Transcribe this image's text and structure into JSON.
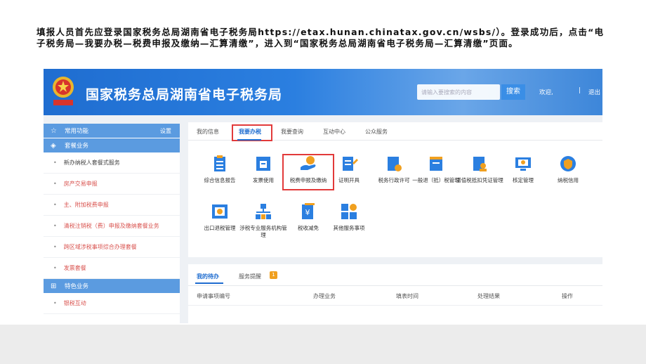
{
  "instruction": "填报人员首先应登录国家税务总局湖南省电子税务局https://etax.hunan.chinatax.gov.cn/wsbs/）。登录成功后，点击“电子税务局—我要办税—税费申报及缴纳—汇算清缴”，进入到“国家税务总局湖南省电子税务局—汇算清缴”页面。",
  "header": {
    "site_title": "国家税务总局湖南省电子税务局",
    "search_placeholder": "请输入要搜索的内容",
    "search_button": "搜索",
    "welcome": "欢迎,",
    "separator": "|",
    "logout": "退出"
  },
  "sidebar": {
    "common_label": "常用功能",
    "settings_label": "设置",
    "package_section": "套餐业务",
    "items": [
      "新办纳税人套餐式服务",
      "房产交易申报",
      "主、附加税费申报",
      "清税注销税（费）申报及缴纳套餐业务",
      "跨区域涉税事项综合办理套餐",
      "发票套餐"
    ],
    "special_section": "特色业务",
    "special_items": [
      "银税互动"
    ]
  },
  "tabs": [
    "我的信息",
    "我要办税",
    "我要查询",
    "互动中心",
    "公众服务"
  ],
  "services": [
    "综合信息报告",
    "发票使用",
    "税费申报及缴纳",
    "证明开具",
    "税务行政许可",
    "一般退（抵）税管理",
    "增值税抵扣凭证管理",
    "核定管理",
    "纳税信用",
    "出口退税管理",
    "涉税专业服务机构管理",
    "税收减免",
    "其他服务事项"
  ],
  "tasks": {
    "tab_pending": "我的待办",
    "tab_reminder": "服务提醒",
    "reminder_count": "1",
    "columns": [
      "申请事项编号",
      "办理业务",
      "填表时间",
      "处理结果",
      "操作"
    ]
  },
  "colors": {
    "brand_blue": "#1f6dd0",
    "highlight_red": "#e23a3a",
    "sidebar_blue": "#5b9be0"
  }
}
